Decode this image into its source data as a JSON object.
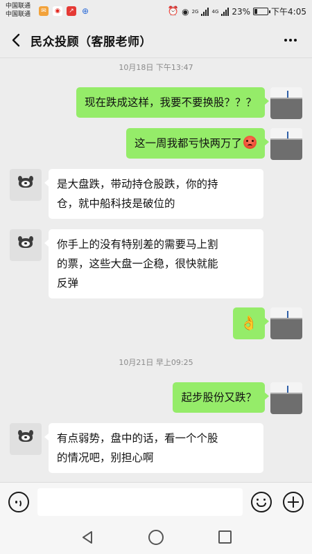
{
  "status_bar": {
    "carrier_1": "中国联通",
    "carrier_2": "中国联通",
    "net_1": "2G",
    "net_2": "4G",
    "battery": "23%",
    "battery_level": 0.23,
    "time": "下午4:05"
  },
  "header": {
    "title": "民众投顾（客服老师）"
  },
  "messages": [
    {
      "type": "timestamp",
      "text": "10月18日 下午13:47"
    },
    {
      "type": "message",
      "sender": "me",
      "text": "现在跌成这样，我要不要换股？？？"
    },
    {
      "type": "message",
      "sender": "me",
      "text": "这一周我都亏快两万了",
      "emoji": "angry-face-emoji"
    },
    {
      "type": "message",
      "sender": "advisor",
      "lines": [
        "是大盘跌，带动持仓股跌，你的持",
        "仓，就中船科技是破位的"
      ]
    },
    {
      "type": "message",
      "sender": "advisor",
      "lines": [
        "你手上的没有特别差的需要马上割",
        "的票，这些大盘一企稳，很快就能",
        "反弹"
      ]
    },
    {
      "type": "message",
      "sender": "me",
      "sticker": "👌",
      "emoji": "ok-hand-emoji"
    },
    {
      "type": "timestamp",
      "text": "10月21日 早上09:25"
    },
    {
      "type": "message",
      "sender": "me",
      "text": "起步股份又跌？"
    },
    {
      "type": "message",
      "sender": "advisor",
      "lines": [
        "有点弱势，盘中的话，看一个个股",
        "的情况吧，别担心啊"
      ]
    }
  ],
  "input_bar": {
    "placeholder": ""
  }
}
